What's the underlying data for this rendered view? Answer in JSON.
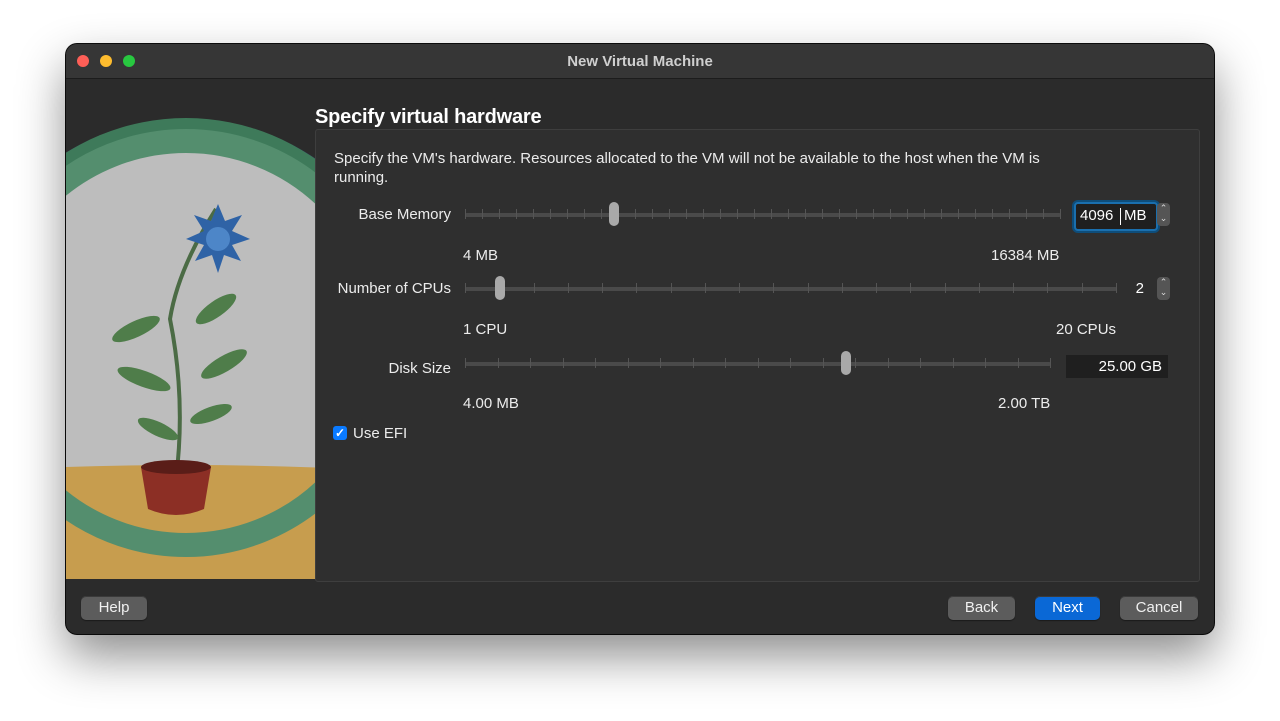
{
  "window": {
    "title": "New Virtual Machine"
  },
  "page": {
    "heading": "Specify virtual hardware",
    "description": "Specify the VM's hardware. Resources allocated to the VM will not be available to the host when the VM is running."
  },
  "memory": {
    "label": "Base Memory",
    "min_label": "4 MB",
    "max_label": "16384 MB",
    "value": "4096",
    "unit": "MB",
    "level": 0.25
  },
  "cpus": {
    "label": "Number of CPUs",
    "min_label": "1 CPU",
    "max_label": "20 CPUs",
    "value": "2",
    "level": 0.053
  },
  "disk": {
    "label": "Disk Size",
    "min_label": "4.00 MB",
    "max_label": "2.00 TB",
    "value": "25.00 GB",
    "level": 0.65
  },
  "efi": {
    "label": "Use EFI",
    "checked": true
  },
  "buttons": {
    "help": "Help",
    "back": "Back",
    "next": "Next",
    "cancel": "Cancel"
  },
  "colors": {
    "accent": "#0a68d6",
    "focus_ring": "#1a6fae",
    "close": "#fe5f57",
    "minimize": "#febc2e",
    "maximize": "#28c840"
  }
}
